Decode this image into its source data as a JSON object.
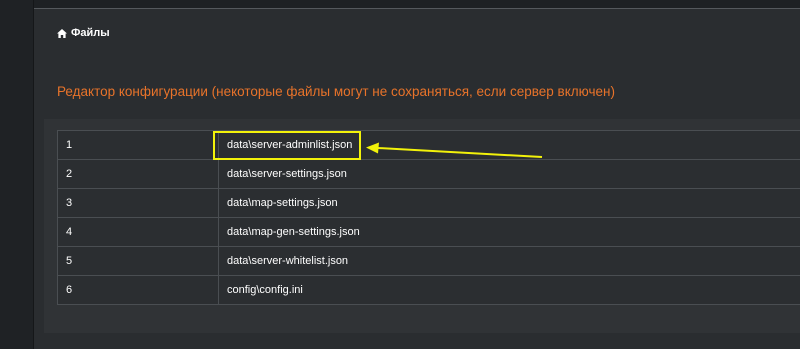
{
  "breadcrumb": {
    "label": "Файлы",
    "icon": "home-icon"
  },
  "page_title": "Редактор конфигурации (некоторые файлы могут не сохраняться, если сервер включен)",
  "files": [
    {
      "num": "1",
      "path": "data\\server-adminlist.json"
    },
    {
      "num": "2",
      "path": "data\\server-settings.json"
    },
    {
      "num": "3",
      "path": "data\\map-settings.json"
    },
    {
      "num": "4",
      "path": "data\\map-gen-settings.json"
    },
    {
      "num": "5",
      "path": "data\\server-whitelist.json"
    },
    {
      "num": "6",
      "path": "config\\config.ini"
    }
  ],
  "colors": {
    "accent": "#e8732a",
    "annotation": "#f2f20a"
  }
}
